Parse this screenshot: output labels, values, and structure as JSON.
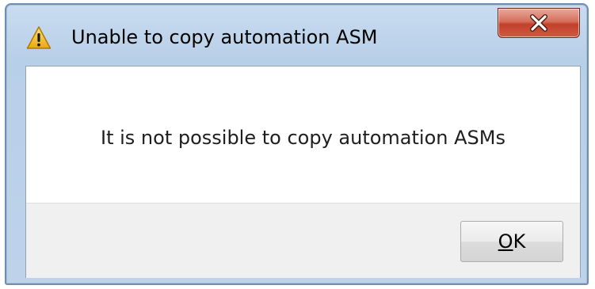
{
  "window": {
    "title": "Unable to copy automation ASM",
    "title_icon": "warning-icon",
    "close_icon": "close-icon"
  },
  "dialog": {
    "message": "It is not possible to copy automation ASMs"
  },
  "buttons": {
    "ok": {
      "mnemonic": "O",
      "rest": "K"
    }
  },
  "colors": {
    "frame": "#b8cfe8",
    "close_button": "#c2402a",
    "warning": "#f2c12e",
    "footer": "#f0f0f0"
  }
}
